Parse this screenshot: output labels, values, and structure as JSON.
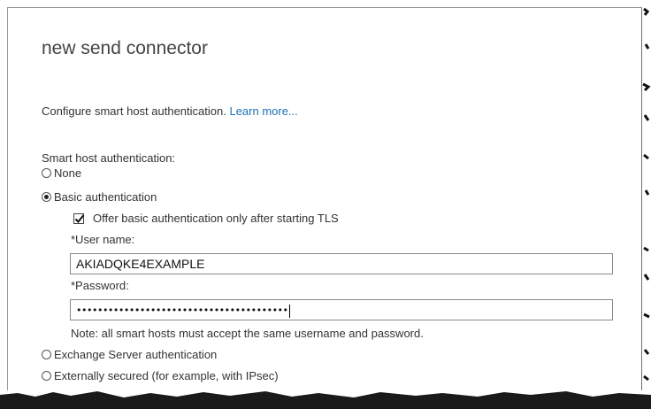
{
  "dialog": {
    "title": "new send connector",
    "intro_text": "Configure smart host authentication.",
    "learn_more": "Learn more...",
    "auth_label": "Smart host authentication:",
    "options": [
      {
        "label": "None",
        "checked": false
      },
      {
        "label": "Basic authentication",
        "checked": true
      },
      {
        "label": "Exchange Server authentication",
        "checked": false
      },
      {
        "label": "Externally secured (for example, with IPsec)",
        "checked": false
      }
    ],
    "tls_checkbox": {
      "label": "Offer basic authentication only after starting TLS",
      "checked": true
    },
    "username": {
      "label": "*User name:",
      "value": "AKIADQKE4EXAMPLE"
    },
    "password": {
      "label": "*Password:",
      "value": "••••••••••••••••••••••••••••••••••••••••"
    },
    "note": "Note: all smart hosts must accept the same username and password."
  },
  "colors": {
    "link": "#1f6fb5",
    "text": "#333333",
    "border": "#8a8a8a"
  }
}
